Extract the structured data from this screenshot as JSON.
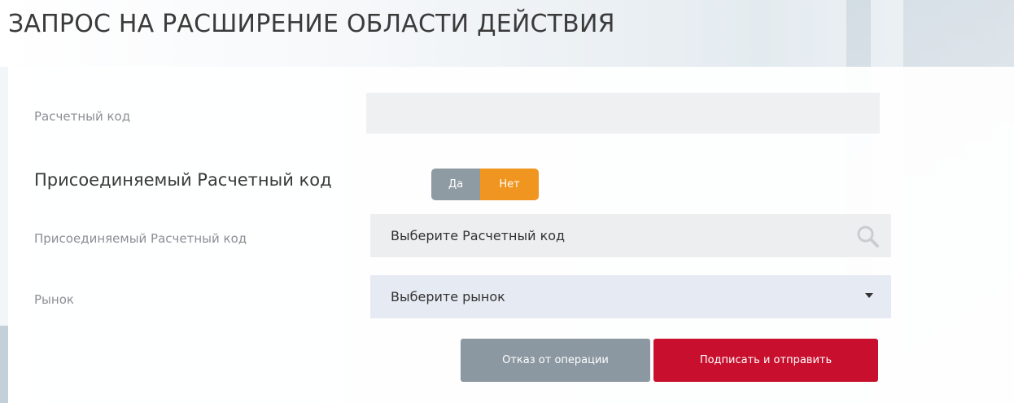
{
  "page": {
    "title": "ЗАПРОС НА РАСШИРЕНИЕ ОБЛАСТИ ДЕЙСТВИЯ"
  },
  "form": {
    "settlement_code": {
      "label": "Расчетный код",
      "value": ""
    },
    "attached_section": {
      "heading": "Присоединяемый Расчетный код",
      "toggle": {
        "yes_label": "Да",
        "no_label": "Нет",
        "selected": "Нет"
      }
    },
    "attached_code": {
      "label": "Присоединяемый Расчетный код",
      "placeholder": "Выберите Расчетный код",
      "icon": "search-icon"
    },
    "market": {
      "label": "Рынок",
      "placeholder": "Выберите рынок",
      "icon": "caret-down-icon"
    }
  },
  "actions": {
    "cancel_label": "Отказ от операции",
    "submit_label": "Подписать и отправить"
  },
  "colors": {
    "toggle_active": "#f0951f",
    "toggle_inactive": "#8f9ba3",
    "cancel_button": "#8b98a1",
    "submit_button": "#c8102e"
  }
}
